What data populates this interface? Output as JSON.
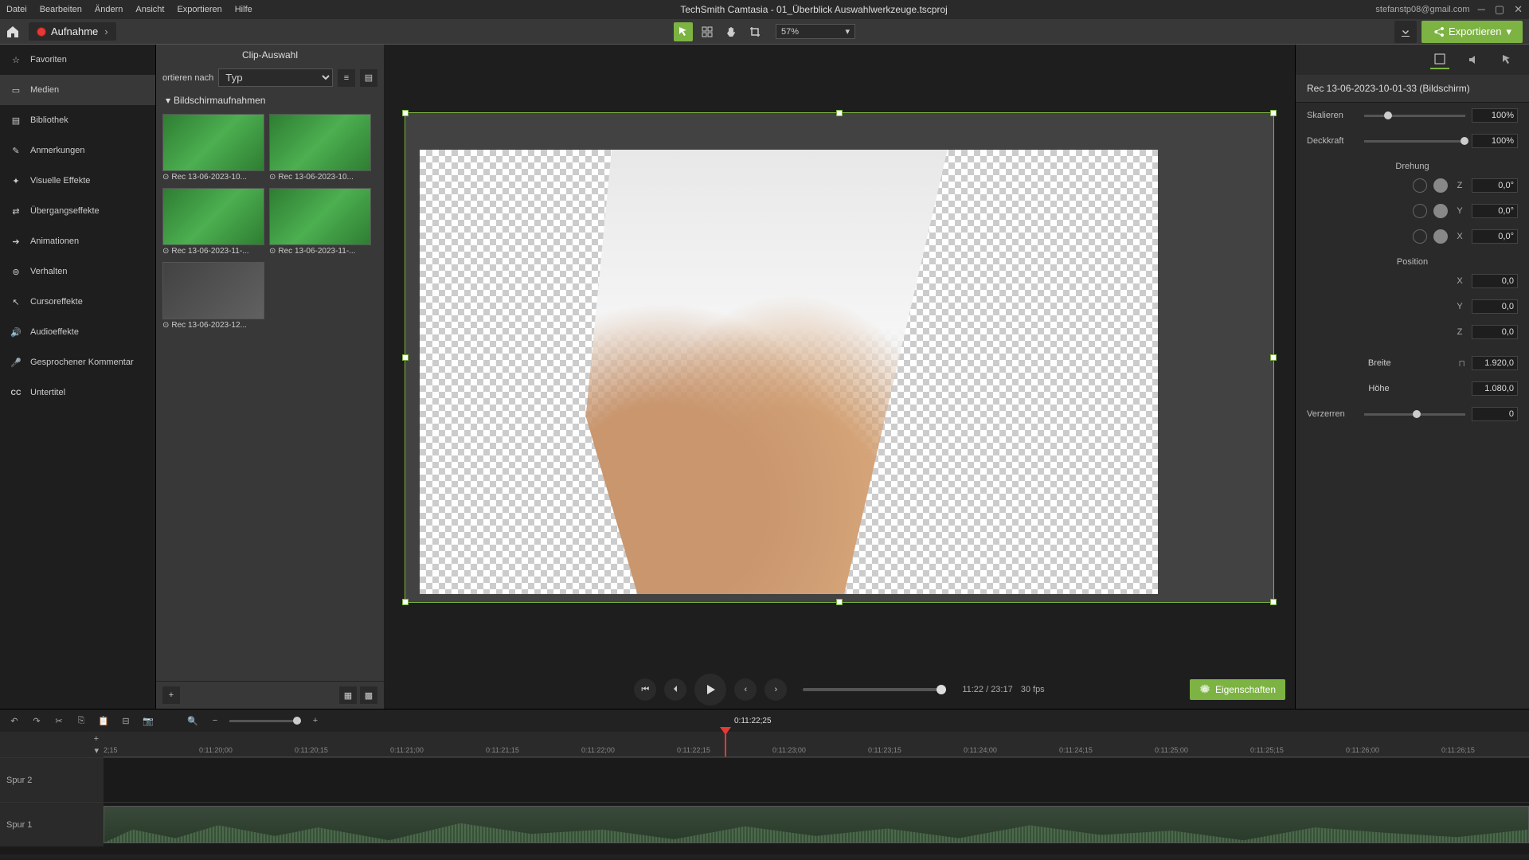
{
  "titlebar": {
    "menu": [
      "Datei",
      "Bearbeiten",
      "Ändern",
      "Ansicht",
      "Exportieren",
      "Hilfe"
    ],
    "title": "TechSmith Camtasia - 01_Überblick Auswahlwerkzeuge.tscproj",
    "user": "stefanstp08@gmail.com"
  },
  "toolbar": {
    "record": "Aufnahme",
    "zoom": "57%",
    "export": "Exportieren"
  },
  "sidebar": {
    "items": [
      {
        "icon": "star",
        "label": "Favoriten"
      },
      {
        "icon": "media",
        "label": "Medien"
      },
      {
        "icon": "library",
        "label": "Bibliothek"
      },
      {
        "icon": "annotation",
        "label": "Anmerkungen"
      },
      {
        "icon": "effects",
        "label": "Visuelle Effekte"
      },
      {
        "icon": "transition",
        "label": "Übergangseffekte"
      },
      {
        "icon": "animation",
        "label": "Animationen"
      },
      {
        "icon": "behavior",
        "label": "Verhalten"
      },
      {
        "icon": "cursor",
        "label": "Cursoreffekte"
      },
      {
        "icon": "audio",
        "label": "Audioeffekte"
      },
      {
        "icon": "mic",
        "label": "Gesprochener Kommentar"
      },
      {
        "icon": "cc",
        "label": "Untertitel"
      }
    ]
  },
  "mediabin": {
    "title": "Clip-Auswahl",
    "sort_label": "ortieren nach",
    "sort_value": "Typ",
    "section": "Bildschirmaufnahmen",
    "clips": [
      "Rec 13-06-2023-10...",
      "Rec 13-06-2023-10...",
      "Rec 13-06-2023-11-...",
      "Rec 13-06-2023-11-...",
      "Rec 13-06-2023-12..."
    ]
  },
  "player": {
    "time": "11:22 / 23:17",
    "fps": "30 fps",
    "properties_btn": "Eigenschaften"
  },
  "properties": {
    "clip_title": "Rec 13-06-2023-10-01-33 (Bildschirm)",
    "scale_label": "Skalieren",
    "scale_value": "100%",
    "opacity_label": "Deckkraft",
    "opacity_value": "100%",
    "rotation_label": "Drehung",
    "rot_z": "0,0°",
    "rot_y": "0,0°",
    "rot_x": "0,0°",
    "position_label": "Position",
    "pos_x": "0,0",
    "pos_y": "0,0",
    "pos_z": "0,0",
    "width_label": "Breite",
    "width_value": "1.920,0",
    "height_label": "Höhe",
    "height_value": "1.080,0",
    "skew_label": "Verzerren",
    "skew_value": "0"
  },
  "timeline": {
    "playhead_time": "0:11:22;25",
    "ticks": [
      "2;15",
      "0:11:20;00",
      "0:11:20;15",
      "0:11:21;00",
      "0:11:21;15",
      "0:11:22;00",
      "0:11:22;15",
      "0:11:23;00",
      "0:11:23;15",
      "0:11:24;00",
      "0:11:24;15",
      "0:11:25;00",
      "0:11:25;15",
      "0:11:26;00",
      "0:11:26;15"
    ],
    "track2": "Spur 2",
    "track1": "Spur 1"
  }
}
